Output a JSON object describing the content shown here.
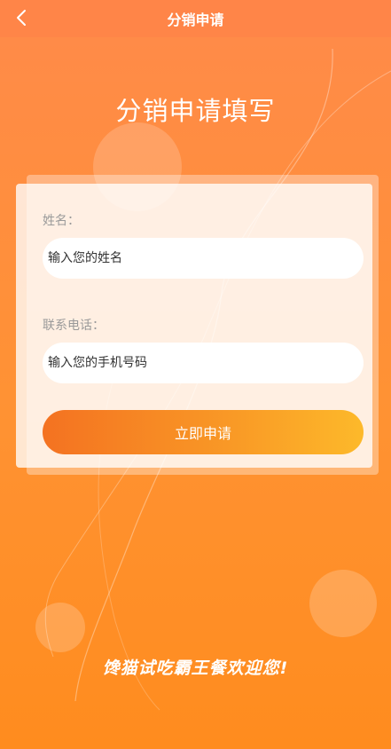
{
  "nav": {
    "title": "分销申请",
    "back_icon": "chevron-left-icon"
  },
  "headline": "分销申请填写",
  "form": {
    "name_label": "姓名：",
    "name_placeholder": "输入您的姓名",
    "phone_label": "联系电话：",
    "phone_placeholder": "输入您的手机号码",
    "submit_label": "立即申请"
  },
  "welcome": "馋猫试吃霸王餐欢迎您!",
  "colors": {
    "nav_bg": "#ff8548",
    "background_top": "#ff8a4a",
    "background_bottom": "#ff8c1e",
    "button_start": "#f47221",
    "button_end": "#fdb92a"
  }
}
